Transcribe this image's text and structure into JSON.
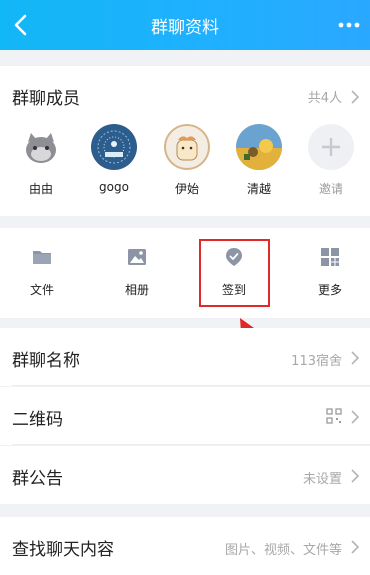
{
  "header": {
    "title": "群聊资料",
    "back_icon": "chevron-left-icon",
    "more_icon": "more-dots-icon"
  },
  "members": {
    "title": "群聊成员",
    "count_text": "共4人",
    "items": [
      {
        "name": "由由"
      },
      {
        "name": "gogo"
      },
      {
        "name": "伊始"
      },
      {
        "name": "清越"
      },
      {
        "name": "邀请"
      }
    ]
  },
  "features": {
    "items": [
      {
        "label": "文件",
        "icon": "folder-icon"
      },
      {
        "label": "相册",
        "icon": "photo-icon"
      },
      {
        "label": "签到",
        "icon": "checkin-icon"
      },
      {
        "label": "更多",
        "icon": "grid-icon"
      }
    ],
    "highlight_color": "#e02a2a"
  },
  "settings": {
    "group_name": {
      "label": "群聊名称",
      "value": "113宿舍"
    },
    "qrcode": {
      "label": "二维码"
    },
    "announcement": {
      "label": "群公告",
      "value": "未设置"
    },
    "search_chat": {
      "label": "查找聊天内容",
      "value": "图片、视频、文件等"
    }
  },
  "colors": {
    "header": "#12b7f5",
    "accent_red": "#e02a2a"
  }
}
